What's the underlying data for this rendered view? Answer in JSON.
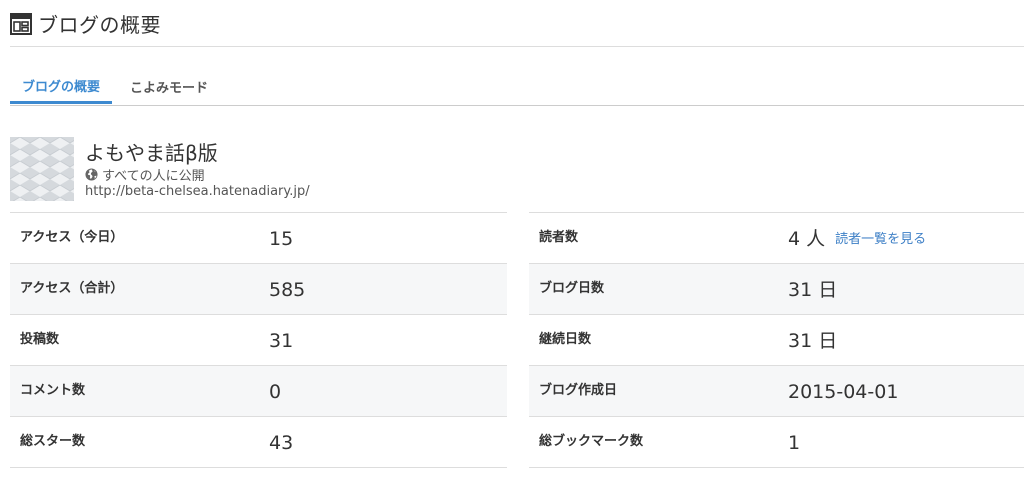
{
  "header": {
    "title": "ブログの概要",
    "icon": "layout-icon"
  },
  "tabs": [
    {
      "label": "ブログの概要",
      "active": true
    },
    {
      "label": "こよみモード",
      "active": false
    }
  ],
  "colors": {
    "accent": "#3d8ad0",
    "link": "#3d7fc6",
    "row_shade": "#f6f7f8",
    "divider": "#dddddd"
  },
  "blog": {
    "title": "よもやま話β版",
    "visibility": "すべての人に公開",
    "visibility_icon": "globe-icon",
    "url": "http://beta-chelsea.hatenadiary.jp/"
  },
  "stats_left": [
    {
      "label": "アクセス（今日）",
      "value": "15"
    },
    {
      "label": "アクセス（合計）",
      "value": "585"
    },
    {
      "label": "投稿数",
      "value": "31"
    },
    {
      "label": "コメント数",
      "value": "0"
    },
    {
      "label": "総スター数",
      "value": "43"
    }
  ],
  "stats_right": [
    {
      "label": "読者数",
      "value": "4 人",
      "link": "読者一覧を見る"
    },
    {
      "label": "ブログ日数",
      "value": "31 日"
    },
    {
      "label": "継続日数",
      "value": "31 日"
    },
    {
      "label": "ブログ作成日",
      "value": "2015-04-01"
    },
    {
      "label": "総ブックマーク数",
      "value": "1"
    }
  ]
}
